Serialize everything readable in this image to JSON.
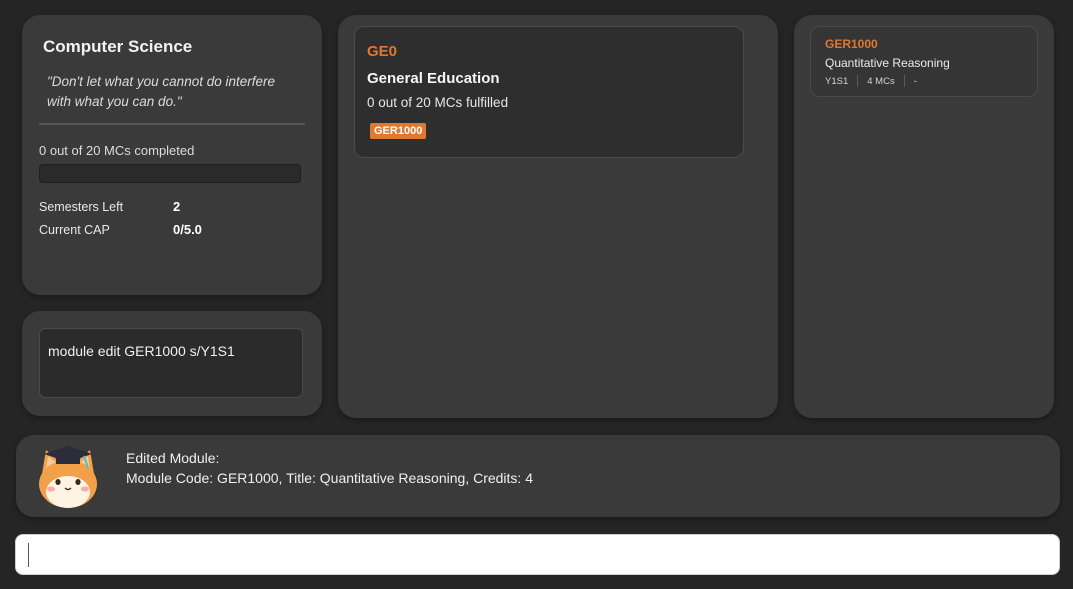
{
  "profile": {
    "major": "Computer Science",
    "quote": "\"Don't let what you cannot do interfere with what you can do.\"",
    "progress_text": "0 out of 20 MCs completed",
    "progress_fraction": 0,
    "stats": [
      {
        "label": "Semesters Left",
        "value": "2"
      },
      {
        "label": "Current CAP",
        "value": "0/5.0"
      }
    ]
  },
  "editor": {
    "text": "module edit GER1000 s/Y1S1"
  },
  "requirements": [
    {
      "code": "GE0",
      "name": "General Education",
      "mcs_text": "0 out of 20 MCs fulfilled",
      "modules": [
        "GER1000"
      ]
    }
  ],
  "modules": [
    {
      "code": "GER1000",
      "title": "Quantitative Reasoning",
      "semester": "Y1S1",
      "credits": "4 MCs",
      "grade": "-"
    }
  ],
  "result": {
    "line1": "Edited Module:",
    "line2": "Module Code: GER1000, Title: Quantitative Reasoning, Credits: 4"
  },
  "command": {
    "value": "",
    "placeholder": ""
  },
  "colors": {
    "accent": "#e0782f",
    "panel": "#3a3a3a",
    "background": "#252525"
  }
}
